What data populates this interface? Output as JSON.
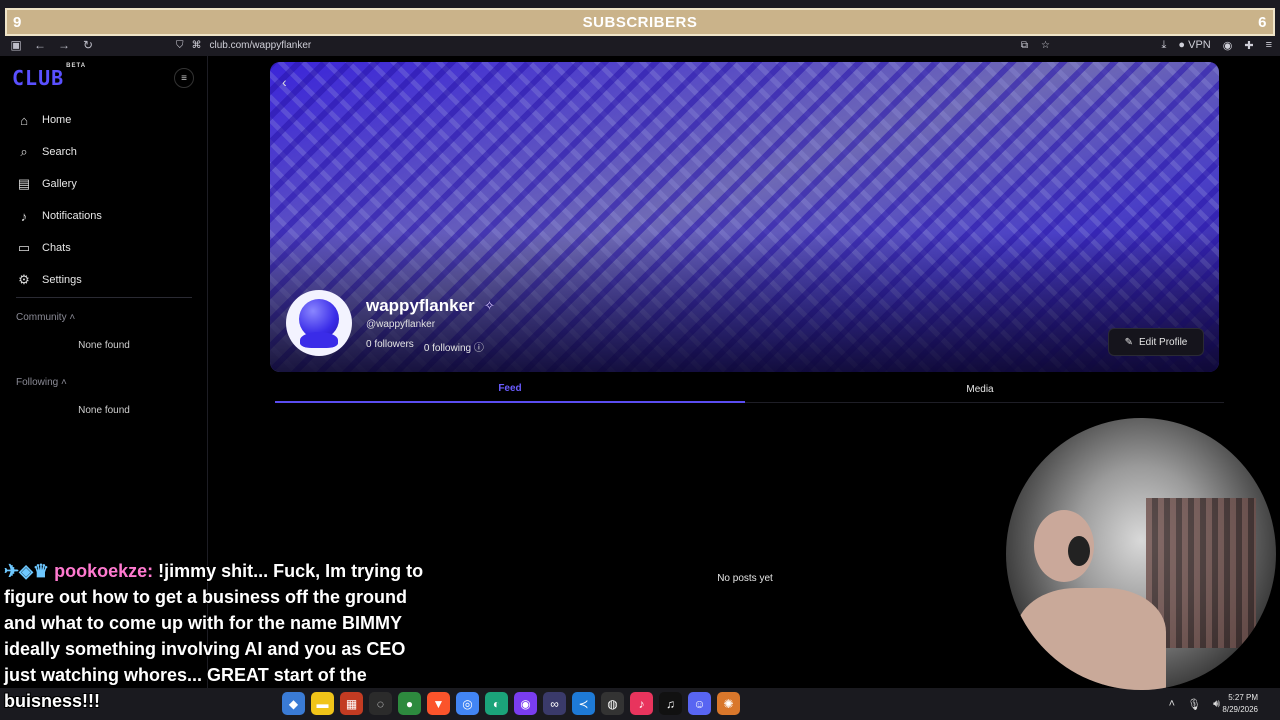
{
  "overlay": {
    "left_count": "9",
    "title": "SUBSCRIBERS",
    "right_count": "6"
  },
  "browser": {
    "url": "club.com/wappyflanker",
    "vpn_label": "VPN"
  },
  "sidebar": {
    "logo": "CLUB",
    "logo_badge": "BETA",
    "items": [
      {
        "label": "Home",
        "icon": "home-icon"
      },
      {
        "label": "Search",
        "icon": "search-icon"
      },
      {
        "label": "Gallery",
        "icon": "gallery-icon"
      },
      {
        "label": "Notifications",
        "icon": "bell-icon"
      },
      {
        "label": "Chats",
        "icon": "chat-icon"
      },
      {
        "label": "Settings",
        "icon": "gear-icon"
      }
    ],
    "community_label": "Community",
    "community_empty": "None found",
    "following_label": "Following",
    "following_empty": "None found"
  },
  "profile": {
    "name": "wappyflanker",
    "handle": "@wappyflanker",
    "followers": "0 followers",
    "following": "0 following",
    "edit_label": "Edit Profile"
  },
  "tabs": [
    {
      "label": "Feed",
      "active": true
    },
    {
      "label": "Media",
      "active": false
    }
  ],
  "feed": {
    "empty_message": "No posts yet"
  },
  "chat": {
    "username": "pookoekze:",
    "message": "!jimmy shit... Fuck, Im trying to figure out how to get a business off the ground and what to come up with for the name BIMMY ideally something involving AI and you as CEO just watching whores... GREAT start of the buisness!!!"
  },
  "taskbar": {
    "time": "5:27 PM",
    "date": "8/29/2026"
  },
  "colors": {
    "accent": "#5a4cf0",
    "overlay_banner": "#cab38a"
  }
}
